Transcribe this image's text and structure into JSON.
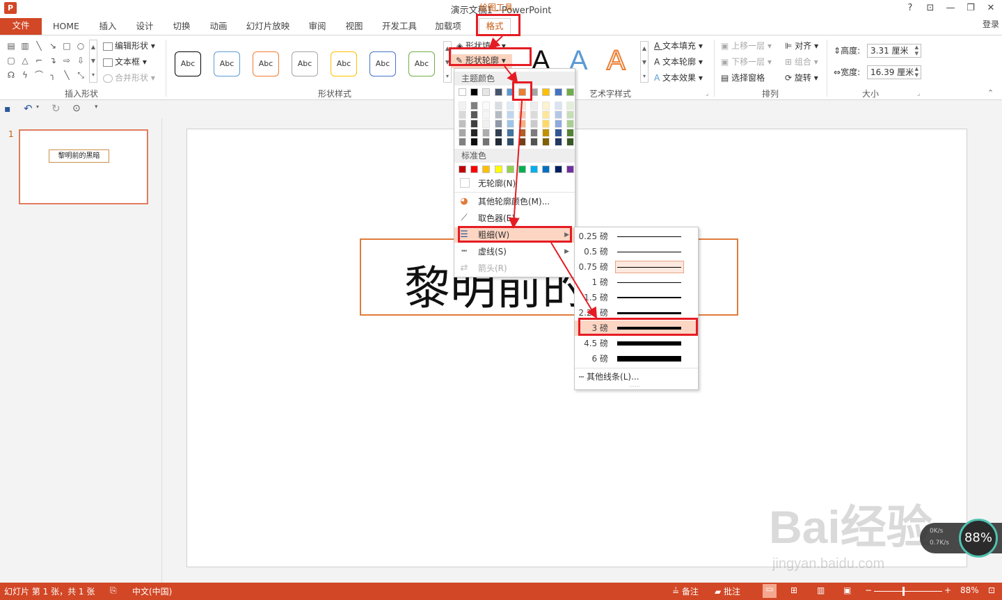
{
  "window": {
    "app_icon": "P",
    "title": "演示文稿1 - PowerPoint",
    "contextual_group": "绘图工具",
    "buttons": [
      "?",
      "⊡",
      "—",
      "❐",
      "✕"
    ],
    "signin": "登录"
  },
  "tabs": [
    {
      "label": "文件"
    },
    {
      "label": "HOME"
    },
    {
      "label": "插入"
    },
    {
      "label": "设计"
    },
    {
      "label": "切换"
    },
    {
      "label": "动画"
    },
    {
      "label": "幻灯片放映"
    },
    {
      "label": "审阅"
    },
    {
      "label": "视图"
    },
    {
      "label": "开发工具"
    },
    {
      "label": "加载项"
    },
    {
      "label": "格式"
    }
  ],
  "ribbon": {
    "insert_shapes": {
      "label": "插入形状",
      "edit_shape": "编辑形状",
      "text_box": "文本框",
      "merge_shapes": "合并形状"
    },
    "shape_styles": {
      "label": "形状样式",
      "preset_label": "Abc",
      "shape_fill": "形状填充",
      "shape_outline": "形状轮廓",
      "preset_colors": [
        "#000000",
        "#5b9bd5",
        "#ed7d31",
        "#a5a5a5",
        "#ffc000",
        "#4472c4",
        "#70ad47"
      ]
    },
    "wordart": {
      "label": "艺术字样式",
      "glyph": "A",
      "text_fill": "文本填充",
      "text_outline": "文本轮廓",
      "text_effects": "文本效果"
    },
    "arrange": {
      "label": "排列",
      "bring_forward": "上移一层",
      "send_backward": "下移一层",
      "selection_pane": "选择窗格",
      "align": "对齐",
      "group": "组合",
      "rotate": "旋转"
    },
    "size": {
      "label": "大小",
      "height_label": "高度:",
      "height_value": "3.31 厘米",
      "width_label": "宽度:",
      "width_value": "16.39 厘米"
    }
  },
  "thumbnail": {
    "number": "1",
    "text": "黎明前的黑暗"
  },
  "slide": {
    "text": "黎明前的黑暗"
  },
  "outline_menu": {
    "theme_colors_label": "主题颜色",
    "theme_colors": [
      "#ffffff",
      "#000000",
      "#e7e6e6",
      "#44546a",
      "#5b9bd5",
      "#ed7d31",
      "#a5a5a5",
      "#ffc000",
      "#4472c4",
      "#70ad47"
    ],
    "standard_colors_label": "标准色",
    "standard_colors": [
      "#c00000",
      "#ff0000",
      "#ffc000",
      "#ffff00",
      "#92d050",
      "#00b050",
      "#00b0f0",
      "#0070c0",
      "#002060",
      "#7030a0"
    ],
    "no_outline": "无轮廓(N)",
    "more_colors": "其他轮廓颜色(M)...",
    "eyedropper": "取色器(E)",
    "weight": "粗细(W)",
    "dashes": "虚线(S)",
    "arrows": "箭头(R)"
  },
  "weight_submenu": {
    "items": [
      {
        "label": "0.25 磅",
        "pt": 0.25
      },
      {
        "label": "0.5 磅",
        "pt": 0.5
      },
      {
        "label": "0.75 磅",
        "pt": 0.75
      },
      {
        "label": "1 磅",
        "pt": 1
      },
      {
        "label": "1.5 磅",
        "pt": 1.5
      },
      {
        "label": "2.25 磅",
        "pt": 2.25
      },
      {
        "label": "3 磅",
        "pt": 3
      },
      {
        "label": "4.5 磅",
        "pt": 4.5
      },
      {
        "label": "6 磅",
        "pt": 6
      }
    ],
    "more_lines": "其他线条(L)...",
    "hovered": "0.75 磅",
    "selected": "3 磅"
  },
  "statusbar": {
    "slide_info": "幻灯片 第 1 张，共 1 张",
    "language": "中文(中国)",
    "notes": "备注",
    "comments": "批注",
    "zoom": "88%"
  },
  "overlay": {
    "net_percent": "88%",
    "net_up": "0K/s",
    "net_down": "0.7K/s",
    "watermark": "Bai经验",
    "watermark_url": "jingyan.baidu.com"
  },
  "annotation_color": "#e51c23"
}
